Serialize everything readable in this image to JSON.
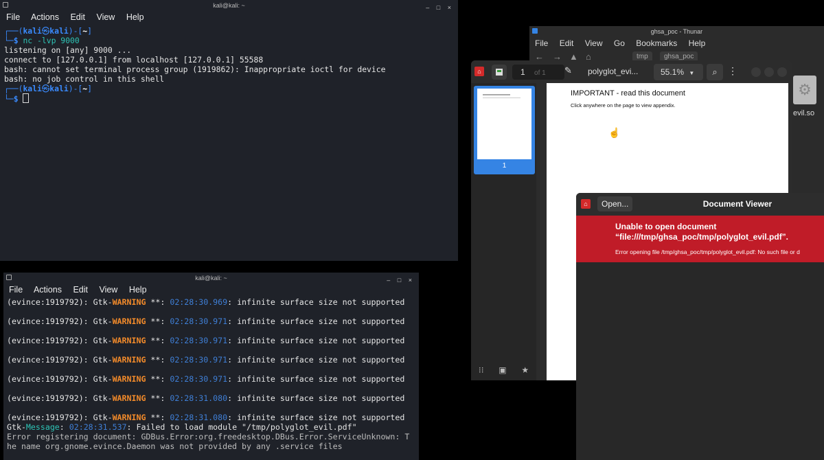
{
  "terminal_top": {
    "title": "kali@kali: ~",
    "menu": [
      "File",
      "Actions",
      "Edit",
      "View",
      "Help"
    ],
    "prompt_user": "kali",
    "prompt_sep": "㉿",
    "prompt_host": "kali",
    "prompt_dir": "~",
    "command": "nc -lvp 9000",
    "output": [
      "listening on [any] 9000 ...",
      "connect to [127.0.0.1] from localhost [127.0.0.1] 55588",
      "bash: cannot set terminal process group (1919862): Inappropriate ioctl for device",
      "bash: no job control in this shell"
    ]
  },
  "terminal_bottom": {
    "title": "kali@kali: ~",
    "menu": [
      "File",
      "Actions",
      "Edit",
      "View",
      "Help"
    ],
    "warnings": [
      {
        "pid": "(evince:1919792): Gtk-",
        "level": "WARNING",
        "stars": " **: ",
        "time": "02:28:30.969",
        "msg": ": infinite surface size not supported"
      },
      {
        "pid": "(evince:1919792): Gtk-",
        "level": "WARNING",
        "stars": " **: ",
        "time": "02:28:30.971",
        "msg": ": infinite surface size not supported"
      },
      {
        "pid": "(evince:1919792): Gtk-",
        "level": "WARNING",
        "stars": " **: ",
        "time": "02:28:30.971",
        "msg": ": infinite surface size not supported"
      },
      {
        "pid": "(evince:1919792): Gtk-",
        "level": "WARNING",
        "stars": " **: ",
        "time": "02:28:30.971",
        "msg": ": infinite surface size not supported"
      },
      {
        "pid": "(evince:1919792): Gtk-",
        "level": "WARNING",
        "stars": " **: ",
        "time": "02:28:30.971",
        "msg": ": infinite surface size not supported"
      },
      {
        "pid": "(evince:1919792): Gtk-",
        "level": "WARNING",
        "stars": " **: ",
        "time": "02:28:31.080",
        "msg": ": infinite surface size not supported"
      },
      {
        "pid": "(evince:1919792): Gtk-",
        "level": "WARNING",
        "stars": " **: ",
        "time": "02:28:31.080",
        "msg": ": infinite surface size not supported"
      }
    ],
    "message_prefix": "Gtk-",
    "message_level": "Message",
    "message_time": "02:28:31.537",
    "message_text": ": Failed to load module \"/tmp/polyglot_evil.pdf\"",
    "error_line1": "Error registering document: GDBus.Error:org.freedesktop.DBus.Error.ServiceUnknown: T",
    "error_line2": "he name org.gnome.evince.Daemon was not provided by any .service files"
  },
  "thunar": {
    "title": "ghsa_poc - Thunar",
    "menu": [
      "File",
      "Edit",
      "View",
      "Go",
      "Bookmarks",
      "Help"
    ],
    "breadcrumbs": [
      "tmp",
      "ghsa_poc"
    ],
    "file_label": "evil.so"
  },
  "evince": {
    "page_number": "1",
    "page_of": "of 1",
    "doc_title": "polyglot_evi...",
    "zoom": "55.1%",
    "thumb_label": "1",
    "page_heading": "IMPORTANT - read this document",
    "page_text": "Click anywhere on the page to view appendix."
  },
  "dialog": {
    "open_label": "Open...",
    "title": "Document Viewer",
    "error_title": "Unable to open document “file:///tmp/ghsa_poc/tmp/polyglot_evil.pdf”.",
    "error_detail": "Error opening file /tmp/ghsa_poc/tmp/polyglot_evil.pdf: No such file or d"
  },
  "colors": {
    "terminal_bg": "#1f2229",
    "prompt_blue": "#3a8bff",
    "warning_orange": "#f38b2a",
    "message_teal": "#2ec4b6",
    "error_red": "#c01c28",
    "selection_blue": "#3584e4"
  }
}
